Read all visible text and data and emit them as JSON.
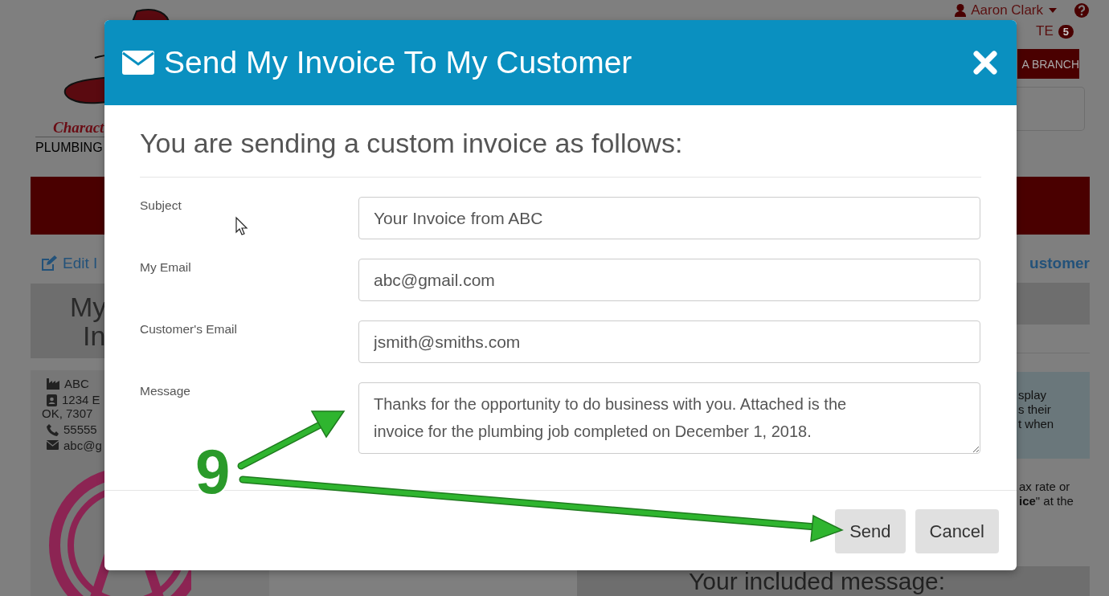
{
  "background_page": {
    "logo_text": "Charact",
    "logo_subtitle": "PLUMBING",
    "user_name": "Aaron Clark",
    "notice": "TE",
    "notice_count": "5",
    "branch_button": "A BRANCH",
    "edit_link": "Edit I",
    "customer_link": "ustomer",
    "title_lines": [
      "My",
      "In"
    ],
    "company": {
      "name": "ABC",
      "address_lines": [
        "1234 E",
        "OK, 7307"
      ],
      "phone": "55555",
      "email": "abc@g"
    },
    "info_lines": [
      "splay",
      "s their",
      "t when"
    ],
    "note_lines": [
      "ax rate or",
      "**ice**\" at the"
    ],
    "message_heading": "Your included message:"
  },
  "dialog": {
    "title": "Send My Invoice To My Customer",
    "heading": "You are sending a custom invoice as follows:",
    "fields": [
      {
        "label": "Subject",
        "value": "Your Invoice from ABC",
        "kind": "input"
      },
      {
        "label": "My Email",
        "value": "abc@gmail.com",
        "kind": "input"
      },
      {
        "label": "Customer's Email",
        "value": "jsmith@smiths.com",
        "kind": "input"
      },
      {
        "label": "Message",
        "value": "Thanks for the opportunity to do business with you. Attached is the invoice for the plumbing job completed on December 1, 2018.",
        "kind": "textarea"
      }
    ],
    "buttons": [
      "Send",
      "Cancel"
    ]
  },
  "annotation": {
    "label": "9"
  }
}
